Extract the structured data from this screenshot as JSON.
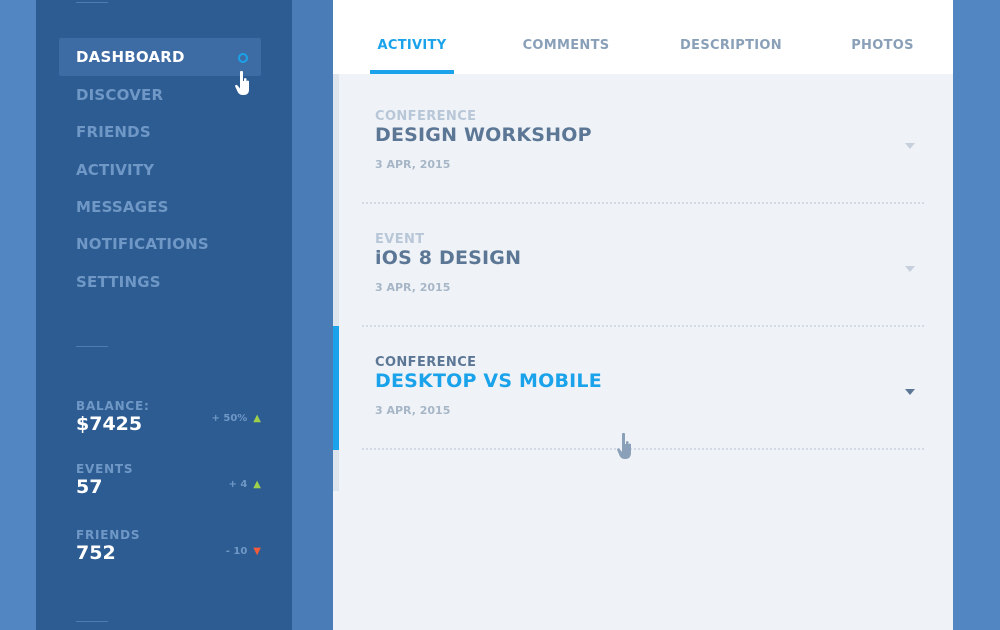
{
  "colors": {
    "accent": "#1aa3ea",
    "up": "#9ed04b",
    "down": "#f15a3a"
  },
  "sidebar": {
    "items": [
      {
        "label": "DASHBOARD",
        "active": true
      },
      {
        "label": "DISCOVER"
      },
      {
        "label": "FRIENDS"
      },
      {
        "label": "ACTIVITY"
      },
      {
        "label": "MESSAGES"
      },
      {
        "label": "NOTIFICATIONS"
      },
      {
        "label": "SETTINGS"
      }
    ],
    "stats": [
      {
        "label": "BALANCE:",
        "value": "$7425",
        "delta": "+ 50%",
        "direction": "up"
      },
      {
        "label": "EVENTS",
        "value": "57",
        "delta": "+ 4",
        "direction": "up"
      },
      {
        "label": "FRIENDS",
        "value": "752",
        "delta": "- 10",
        "direction": "down"
      }
    ]
  },
  "tabs": [
    {
      "label": "ACTIVITY",
      "active": true
    },
    {
      "label": "COMMENTS"
    },
    {
      "label": "DESCRIPTION"
    },
    {
      "label": "PHOTOS"
    }
  ],
  "activity": [
    {
      "category": "CONFERENCE",
      "title": "DESIGN WORKSHOP",
      "date": "3 APR, 2015"
    },
    {
      "category": "EVENT",
      "title": "iOS 8 DESIGN",
      "date": "3 APR, 2015"
    },
    {
      "category": "CONFERENCE",
      "title": "DESKTOP VS MOBILE",
      "date": "3 APR, 2015",
      "active": true
    }
  ]
}
